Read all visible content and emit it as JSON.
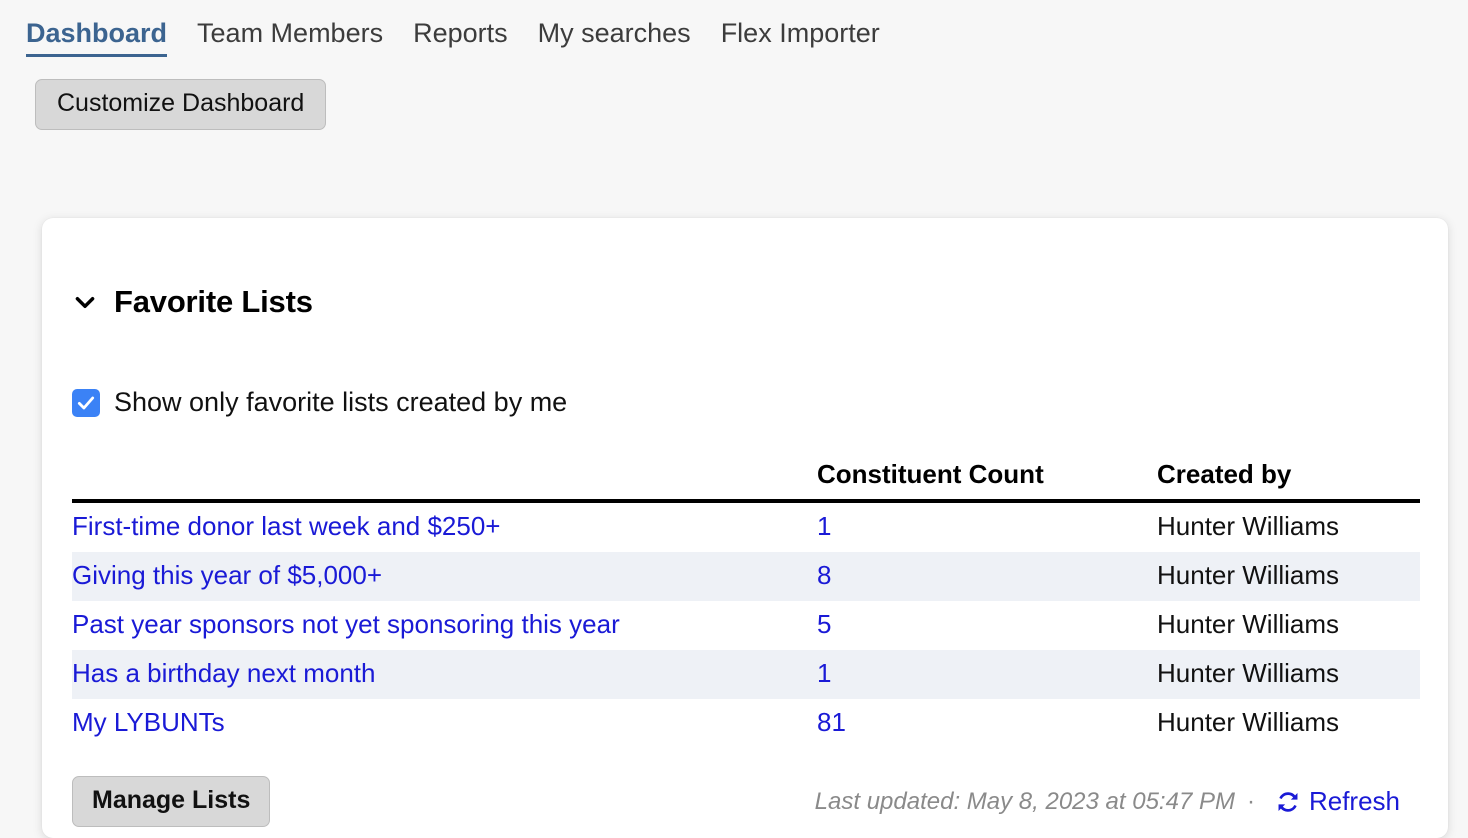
{
  "nav": {
    "tabs": [
      {
        "label": "Dashboard",
        "active": true
      },
      {
        "label": "Team Members",
        "active": false
      },
      {
        "label": "Reports",
        "active": false
      },
      {
        "label": "My searches",
        "active": false
      },
      {
        "label": "Flex Importer",
        "active": false
      }
    ]
  },
  "toolbar": {
    "customize_label": "Customize Dashboard"
  },
  "card": {
    "title": "Favorite Lists",
    "collapse_icon": "chevron-down-icon",
    "filter": {
      "label": "Show only favorite lists created by me",
      "checked": true
    },
    "table": {
      "headers": {
        "name": "",
        "count": "Constituent Count",
        "created_by": "Created by"
      },
      "rows": [
        {
          "name": "First-time donor last week and $250+",
          "count": "1",
          "created_by": "Hunter Williams"
        },
        {
          "name": "Giving this year of $5,000+",
          "count": "8",
          "created_by": "Hunter Williams"
        },
        {
          "name": "Past year sponsors not yet sponsoring this year",
          "count": "5",
          "created_by": "Hunter Williams"
        },
        {
          "name": "Has a birthday next month",
          "count": "1",
          "created_by": "Hunter Williams"
        },
        {
          "name": "My LYBUNTs",
          "count": "81",
          "created_by": "Hunter Williams"
        }
      ]
    },
    "footer": {
      "manage_label": "Manage Lists",
      "last_updated": "Last updated: May 8, 2023 at 05:47 PM",
      "separator": "·",
      "refresh_label": "Refresh",
      "refresh_icon": "refresh-icon"
    }
  },
  "colors": {
    "accent_blue": "#3c6490",
    "link_blue": "#1a1ad6",
    "checkbox_blue": "#3b82f6",
    "row_stripe": "#eef1f6",
    "page_bg": "#f7f7f7",
    "button_gray": "#d8d8d8"
  }
}
